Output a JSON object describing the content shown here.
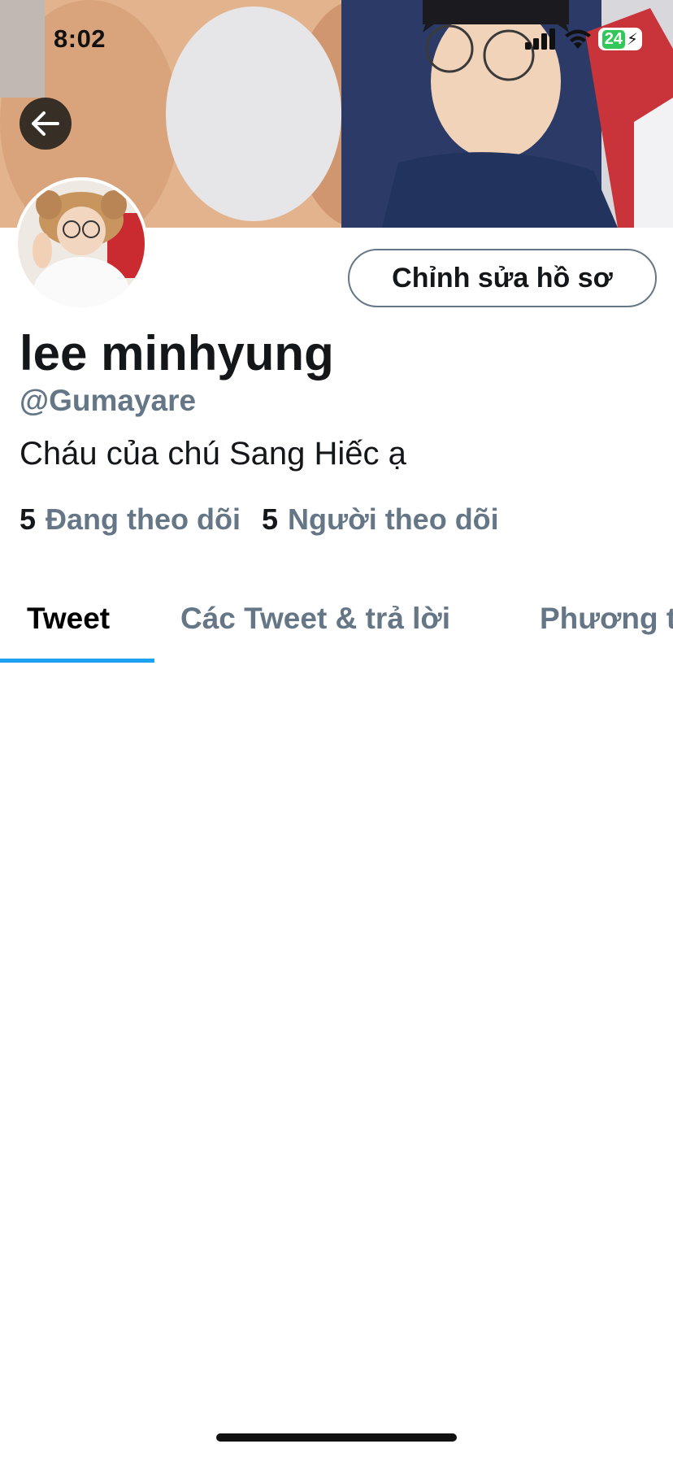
{
  "status_bar": {
    "time": "8:02",
    "battery": "24"
  },
  "header": {
    "back_icon": "arrow-left-icon"
  },
  "profile": {
    "edit_button_label": "Chỉnh sửa hồ sơ",
    "display_name": "lee minhyung",
    "handle": "@Gumayare",
    "bio": "Cháu của chú Sang Hiếc ạ",
    "following_count": "5",
    "following_label": "Đang theo dõi",
    "followers_count": "5",
    "followers_label": "Người theo dõi"
  },
  "tabs": [
    {
      "label": "Tweet",
      "active": true
    },
    {
      "label": "Các Tweet & trả lời",
      "active": false
    },
    {
      "label": "Phương tiện",
      "active": false
    }
  ],
  "colors": {
    "accent": "#1da1f2",
    "secondary_text": "#657786",
    "primary_text": "#14171a",
    "battery_green": "#33c759"
  }
}
